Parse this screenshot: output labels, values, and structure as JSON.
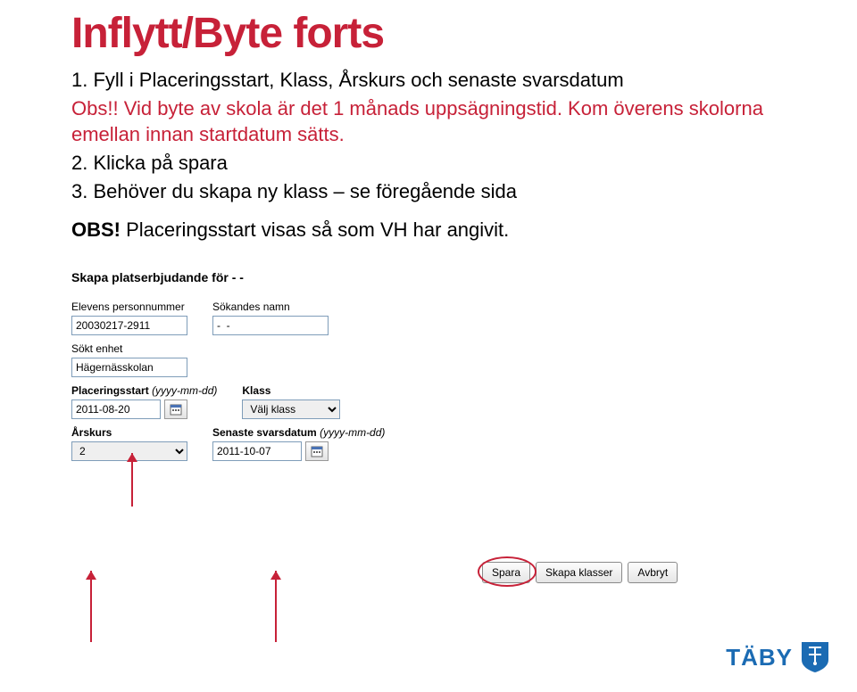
{
  "title": "Inflytt/Byte forts",
  "instructions": {
    "line1": "1. Fyll i Placeringsstart, Klass, Årskurs och senaste svarsdatum",
    "obs_prefix": "Obs!! ",
    "obs_body": "Vid byte av skola är det 1 månads uppsägningstid. Kom överens skolorna emellan innan startdatum sätts.",
    "line2": "2. Klicka på spara",
    "line3": "3. Behöver du skapa ny klass – se föregående sida",
    "obs_bold": "OBS!",
    "obs_tail": " Placeringsstart visas så som VH har angivit."
  },
  "form": {
    "heading": "Skapa platserbjudande för  -  -",
    "elev_label": "Elevens personnummer",
    "elev_value": "20030217-2911",
    "sokande_label": "Sökandes namn",
    "sokande_value": "-  -",
    "sokt_label": "Sökt enhet",
    "sokt_value": "Hägernässkolan",
    "placstart_label": "Placeringsstart",
    "placstart_hint": "(yyyy-mm-dd)",
    "placstart_value": "2011-08-20",
    "klass_label": "Klass",
    "klass_option": "Välj klass",
    "arskurs_label": "Årskurs",
    "arskurs_option": "2",
    "svars_label": "Senaste svarsdatum",
    "svars_hint": "(yyyy-mm-dd)",
    "svars_value": "2011-10-07"
  },
  "buttons": {
    "spara": "Spara",
    "skapa": "Skapa klasser",
    "avbryt": "Avbryt"
  },
  "logo_text": "TÄBY"
}
